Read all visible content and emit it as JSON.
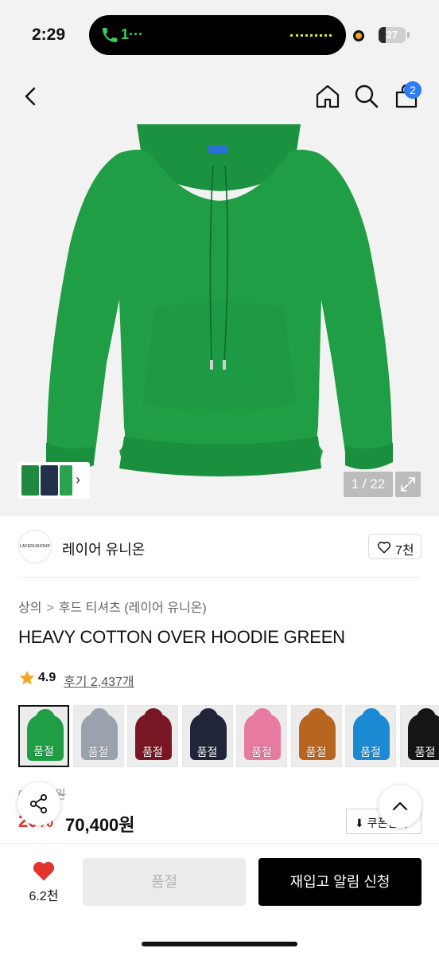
{
  "status_bar": {
    "time": "2:29",
    "call_text": "1···",
    "battery_level": "27",
    "battery_fraction": 0.27
  },
  "header": {
    "back_icon": "chevron-left-icon",
    "home_icon": "home-icon",
    "search_icon": "search-icon",
    "cart_icon": "shopping-bag-icon",
    "cart_count": "2"
  },
  "gallery": {
    "counter": "1 / 22",
    "current": 1,
    "total": 22,
    "product_color": "#1f9e45"
  },
  "brand": {
    "logo_text": "LAYERUNION®",
    "name": "레이어 유니온",
    "like_count": "7천"
  },
  "breadcrumb": {
    "level1": "상의",
    "level2": "후드 티셔츠 (레이어 유니온)"
  },
  "product": {
    "title": "HEAVY COTTON OVER HOODIE GREEN",
    "rating": "4.9",
    "reviews": "후기 2,437개"
  },
  "swatches": [
    {
      "color": "#1f9e45",
      "label": "품절"
    },
    {
      "color": "#9aa3ad",
      "label": "품절"
    },
    {
      "color": "#7a1724",
      "label": "품절"
    },
    {
      "color": "#20253a",
      "label": "품절"
    },
    {
      "color": "#e77aa0",
      "label": "품절"
    },
    {
      "color": "#b8651f",
      "label": "품절"
    },
    {
      "color": "#1b8ad3",
      "label": "품절"
    },
    {
      "color": "#151515",
      "label": "품절"
    }
  ],
  "price": {
    "original": "88,000원",
    "discount": "20%",
    "sale": "70,400원",
    "coupon_label": "⬇ 쿠폰받기"
  },
  "bottom_bar": {
    "wish_count": "6.2천",
    "soldout_label": "품절",
    "restock_label": "재입고 알림 신청"
  },
  "colors": {
    "accent_red": "#e2342f",
    "badge_blue": "#2d7cf6"
  }
}
